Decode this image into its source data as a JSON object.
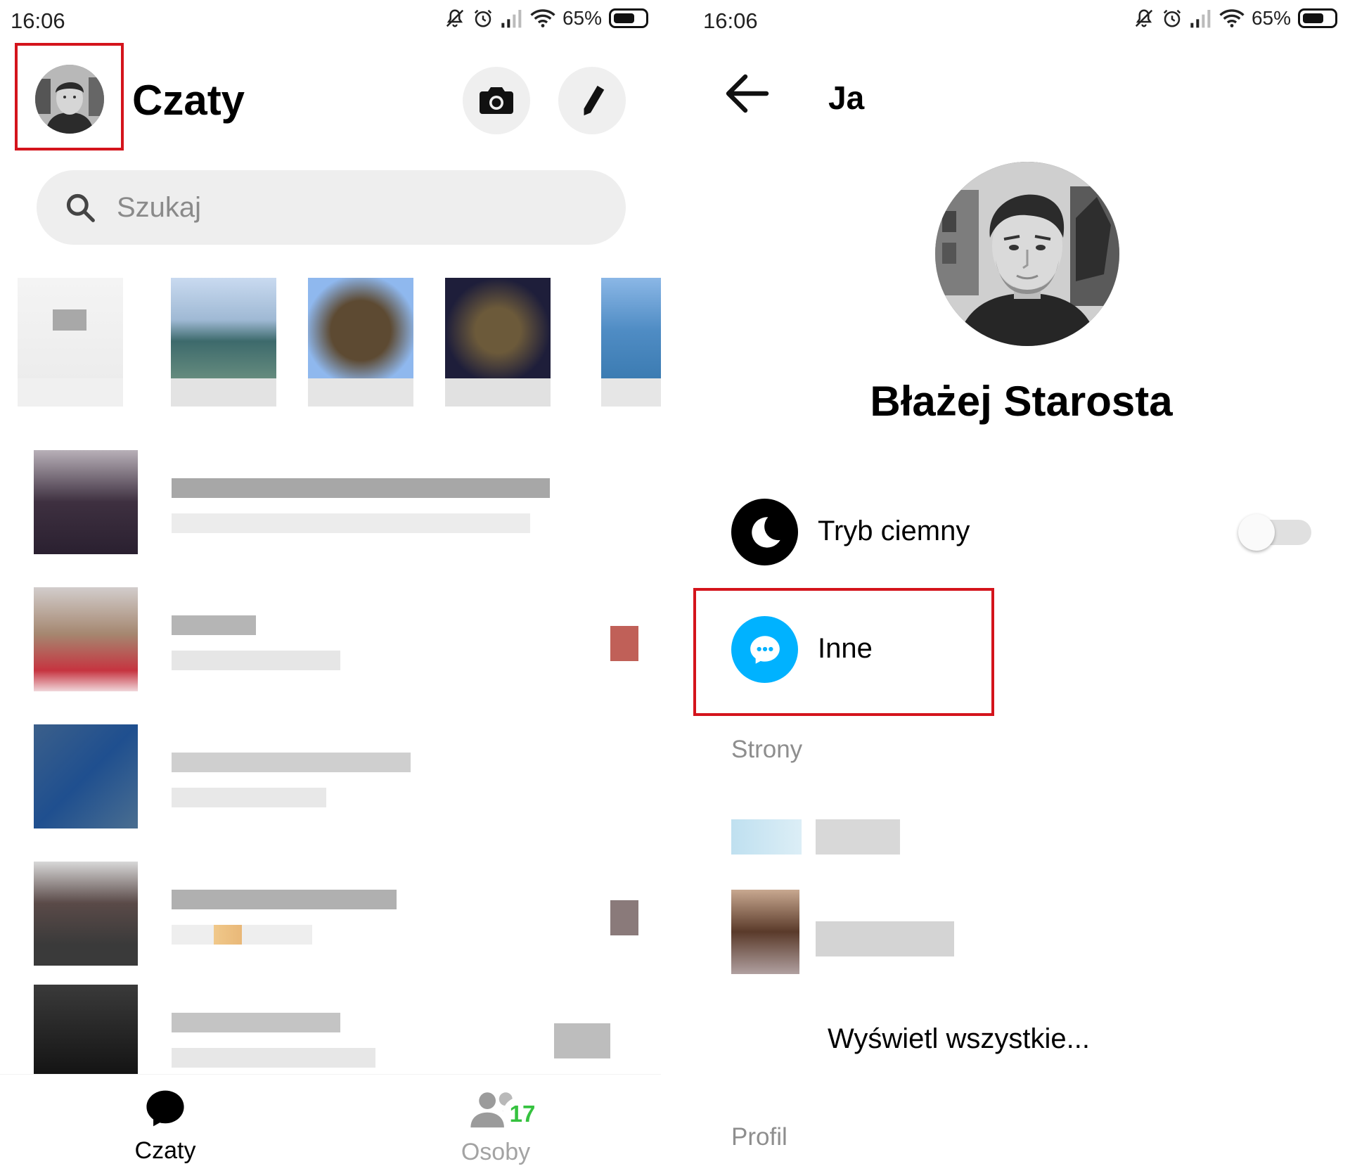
{
  "status_bar": {
    "time": "16:06",
    "battery": "65%",
    "battery_level": 0.65
  },
  "chats_screen": {
    "title": "Czaty",
    "search": {
      "placeholder": "Szukaj"
    },
    "bottom_nav": {
      "chats_label": "Czaty",
      "people_label": "Osoby",
      "people_badge": "17"
    }
  },
  "profile_screen": {
    "header_title": "Ja",
    "profile_name": "Błażej Starosta",
    "dark_mode": {
      "label": "Tryb ciemny",
      "enabled": false
    },
    "other": {
      "label": "Inne"
    },
    "pages_section": {
      "title": "Strony",
      "view_all": "Wyświetl wszystkie..."
    },
    "profile_section": {
      "title": "Profil"
    }
  },
  "colors": {
    "highlight": "#d4141c",
    "messenger_blue": "#00b2ff",
    "badge_green": "#35c23f",
    "dark_icon": "#000000"
  }
}
